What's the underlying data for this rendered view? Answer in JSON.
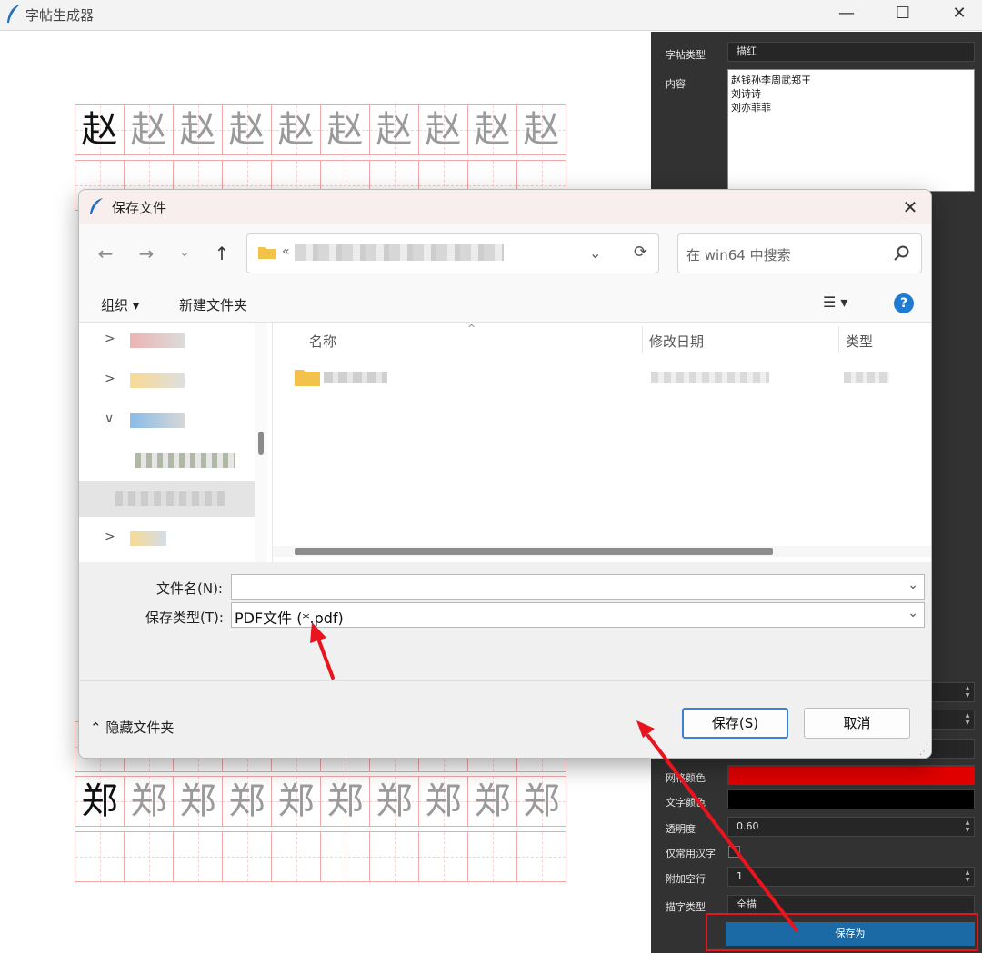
{
  "window": {
    "title": "字帖生成器",
    "min_glyph": "—",
    "max_glyph": "☐",
    "close_glyph": "✕"
  },
  "copybook": {
    "row1_char": "赵",
    "row_last_char": "郑",
    "cells_per_row": 10
  },
  "panel": {
    "type_label": "字帖类型",
    "type_value": "描红",
    "content_label": "内容",
    "content_lines": [
      "赵钱孙李周武郑王",
      "刘诗诗",
      "刘亦菲菲"
    ],
    "grid_color_label": "网格颜色",
    "grid_color": "#e00000",
    "text_color_label": "文字颜色",
    "text_color": "#000000",
    "opacity_label": "透明度",
    "opacity_value": "0.60",
    "common_only_label": "仅常用汉字",
    "extra_rows_label": "附加空行",
    "extra_rows_value": "1",
    "trace_type_label": "描字类型",
    "trace_type_value": "全描",
    "save_as_label": "保存为"
  },
  "dialog": {
    "title": "保存文件",
    "close_glyph": "✕",
    "nav": {
      "back": "←",
      "forward": "→",
      "recent": "⌄",
      "up": "↑",
      "path_prefix": "«",
      "chevron": "⌄",
      "refresh": "⟳"
    },
    "search_placeholder": "在 win64 中搜索",
    "organize_label": "组织 ▾",
    "new_folder_label": "新建文件夹",
    "view_glyph": "☰ ▾",
    "help_glyph": "?",
    "columns": {
      "name": "名称",
      "date": "修改日期",
      "type": "类型"
    },
    "sort_glyph": "^",
    "nav_expanders": [
      ">",
      ">",
      "∨",
      "",
      "",
      ">"
    ],
    "filename_label": "文件名(N):",
    "filename_value": "",
    "filetype_label": "保存类型(T):",
    "filetype_value": "PDF文件 (*.pdf)",
    "hide_folders_label": "⌃ 隐藏文件夹",
    "save_button": "保存(S)",
    "cancel_button": "取消"
  },
  "colors": {
    "accent": "#1b6aa5",
    "annotation_red": "#e8141e",
    "panel_bg": "#323232"
  }
}
